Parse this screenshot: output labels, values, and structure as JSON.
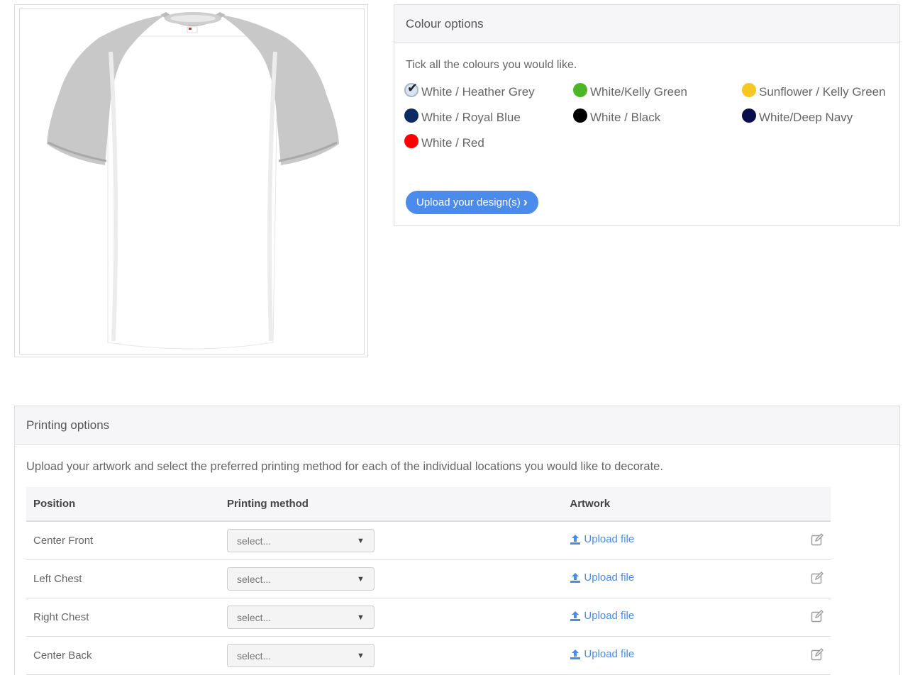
{
  "product": {
    "image_icon": "tshirt-raglan-white-heather-grey"
  },
  "colour_options": {
    "title": "Colour options",
    "intro": "Tick all the colours you would like.",
    "swatches": [
      {
        "label": "White / Heather Grey",
        "color": "#d8e4f3",
        "selected": true
      },
      {
        "label": "White/Kelly Green",
        "color": "#4cb724",
        "selected": false
      },
      {
        "label": "Sunflower / Kelly Green",
        "color": "#f4c722",
        "selected": false
      },
      {
        "label": "White / Royal Blue",
        "color": "#0d2b63",
        "selected": false
      },
      {
        "label": "White / Black",
        "color": "#000000",
        "selected": false
      },
      {
        "label": "White/Deep Navy",
        "color": "#0a0d4c",
        "selected": false
      },
      {
        "label": "White / Red",
        "color": "#ff0000",
        "selected": false
      }
    ],
    "upload_button": "Upload your design(s)"
  },
  "printing_options": {
    "title": "Printing options",
    "intro": "Upload your artwork and select the preferred printing method for each of the individual locations you would like to decorate.",
    "columns": [
      "Position",
      "Printing method",
      "Artwork"
    ],
    "rows": [
      {
        "position": "Center Front",
        "method": "select...",
        "artwork": "Upload file"
      },
      {
        "position": "Left Chest",
        "method": "select...",
        "artwork": "Upload file"
      },
      {
        "position": "Right Chest",
        "method": "select...",
        "artwork": "Upload file"
      },
      {
        "position": "Center Back",
        "method": "select...",
        "artwork": "Upload file"
      }
    ]
  },
  "colors": {
    "accent": "#4a8bec",
    "panel_heading_bg": "#f6f6f8",
    "border": "#dddddd"
  }
}
